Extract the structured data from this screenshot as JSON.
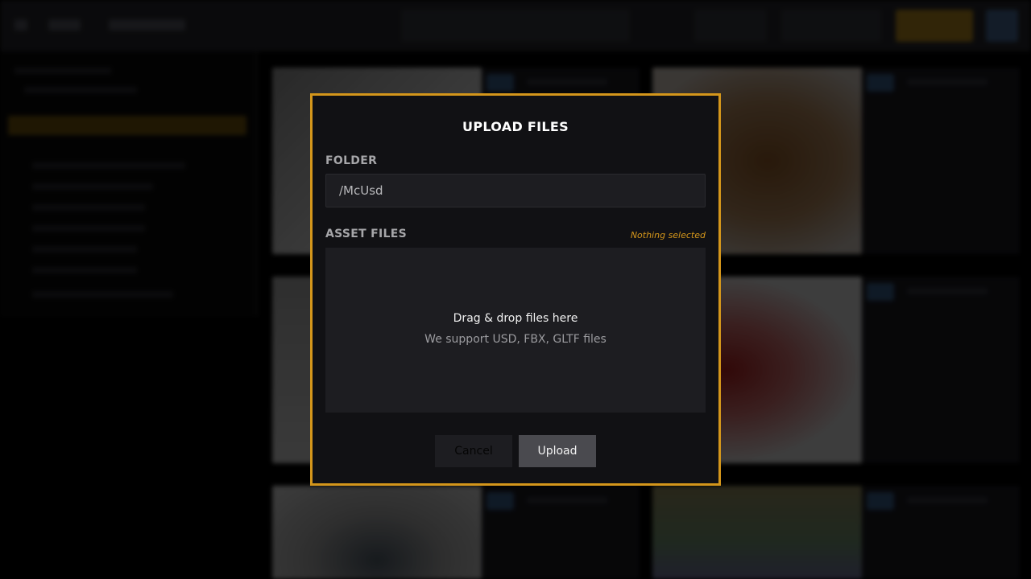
{
  "modal": {
    "title": "UPLOAD FILES",
    "folder_label": "FOLDER",
    "folder_value": "/McUsd",
    "asset_files_label": "ASSET FILES",
    "selection_status": "Nothing selected",
    "dropzone": {
      "primary_text": "Drag & drop files here",
      "secondary_text": "We support USD, FBX, GLTF files"
    },
    "buttons": {
      "cancel_label": "Cancel",
      "upload_label": "Upload"
    }
  },
  "colors": {
    "accent": "#d4961b",
    "modal_background": "#111114",
    "field_background": "#1d1d21",
    "upload_button": "#4a4a4f"
  },
  "icons": [
    "back-arrow-icon",
    "user-avatar-icon"
  ]
}
